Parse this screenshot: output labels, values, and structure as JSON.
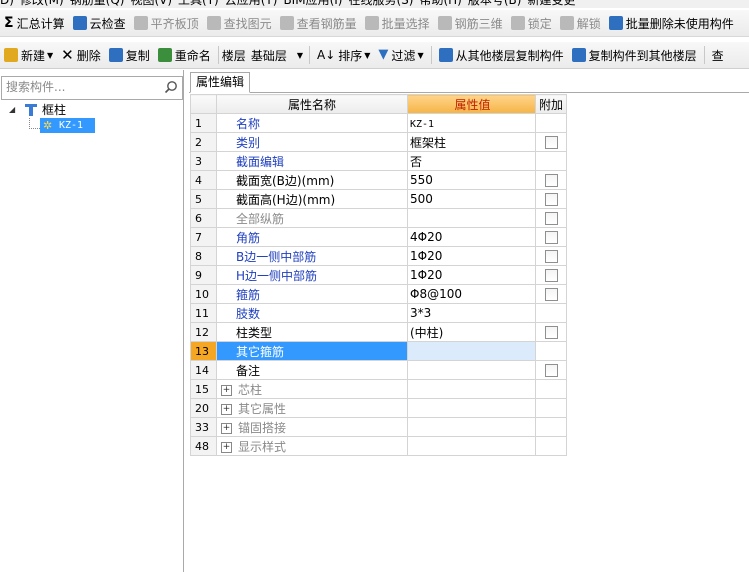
{
  "menu": [
    "D)",
    "修改(M)",
    "钢筋量(Q)",
    "视图(V)",
    "工具(T)",
    "云应用(Y)",
    "BIM应用(I)",
    "在线服务(S)",
    "帮助(H)",
    "版本号(B)",
    "新建变更"
  ],
  "toolbar1": {
    "sum_label": "汇总计算",
    "cloud_check_label": "云检查",
    "flat_slab_label": "平齐板顶",
    "find_label": "查找图元",
    "view_rebar_label": "查看钢筋量",
    "batch_select_label": "批量选择",
    "rebar3d_label": "钢筋三维",
    "lock_label": "锁定",
    "unlock_label": "解锁",
    "batch_delete_label": "批量删除未使用构件"
  },
  "toolbar2": {
    "new_label": "新建",
    "delete_label": "删除",
    "copy_label": "复制",
    "rename_label": "重命名",
    "floor_label": "楼层",
    "floor_value": "基础层",
    "sort_label": "排序",
    "filter_label": "过滤",
    "copy_from_label": "从其他楼层复制构件",
    "copy_to_label": "复制构件到其他楼层",
    "find_label": "查"
  },
  "left": {
    "search_placeholder": "搜索构件...",
    "tree_root": "框柱",
    "tree_child": "KZ-1"
  },
  "right": {
    "tab_label": "属性编辑",
    "headers": {
      "name": "属性名称",
      "value": "属性值",
      "extra": "附加"
    },
    "rows": [
      {
        "num": "1",
        "name": "名称",
        "value": "KZ-1",
        "style": "blue",
        "check": false,
        "expander": false,
        "mono": true
      },
      {
        "num": "2",
        "name": "类别",
        "value": "框架柱",
        "style": "blue",
        "check": true,
        "expander": false
      },
      {
        "num": "3",
        "name": "截面编辑",
        "value": "否",
        "style": "blue",
        "check": false,
        "expander": false
      },
      {
        "num": "4",
        "name": "截面宽(B边)(mm)",
        "value": "550",
        "style": "black",
        "check": true,
        "expander": false
      },
      {
        "num": "5",
        "name": "截面高(H边)(mm)",
        "value": "500",
        "style": "black",
        "check": true,
        "expander": false
      },
      {
        "num": "6",
        "name": "全部纵筋",
        "value": "",
        "style": "gray",
        "check": true,
        "expander": false
      },
      {
        "num": "7",
        "name": "角筋",
        "value": "4Φ20",
        "style": "blue",
        "check": true,
        "expander": false
      },
      {
        "num": "8",
        "name": "B边一侧中部筋",
        "value": "1Φ20",
        "style": "blue",
        "check": true,
        "expander": false
      },
      {
        "num": "9",
        "name": "H边一侧中部筋",
        "value": "1Φ20",
        "style": "blue",
        "check": true,
        "expander": false
      },
      {
        "num": "10",
        "name": "箍筋",
        "value": "Φ8@100",
        "style": "blue",
        "check": true,
        "expander": false
      },
      {
        "num": "11",
        "name": "肢数",
        "value": "3*3",
        "style": "blue",
        "check": false,
        "expander": false
      },
      {
        "num": "12",
        "name": "柱类型",
        "value": "(中柱)",
        "style": "black",
        "check": true,
        "expander": false
      },
      {
        "num": "13",
        "name": "其它箍筋",
        "value": "",
        "style": "selected",
        "check": false,
        "expander": false
      },
      {
        "num": "14",
        "name": "备注",
        "value": "",
        "style": "black",
        "check": true,
        "expander": false
      },
      {
        "num": "15",
        "name": "芯柱",
        "value": "",
        "style": "gray",
        "check": false,
        "expander": true
      },
      {
        "num": "20",
        "name": "其它属性",
        "value": "",
        "style": "gray",
        "check": false,
        "expander": true
      },
      {
        "num": "33",
        "name": "锚固搭接",
        "value": "",
        "style": "gray",
        "check": false,
        "expander": true
      },
      {
        "num": "48",
        "name": "显示样式",
        "value": "",
        "style": "gray",
        "check": false,
        "expander": true
      }
    ]
  }
}
